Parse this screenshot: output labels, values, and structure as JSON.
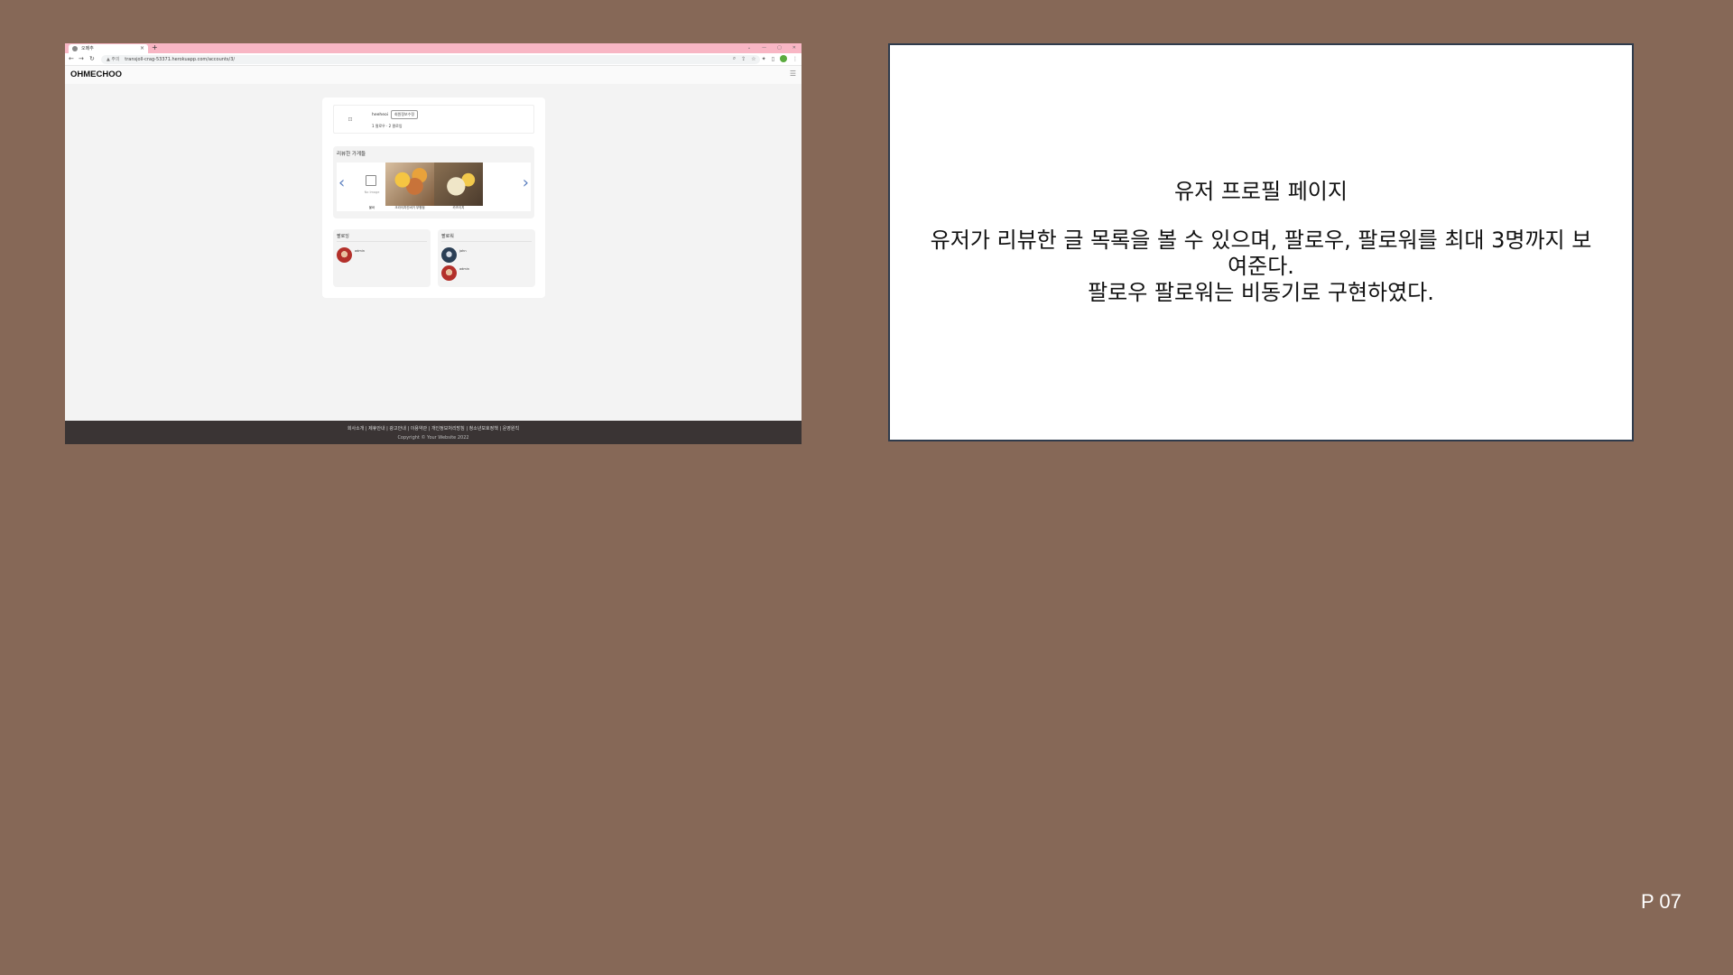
{
  "browser": {
    "tab_title": "오메추",
    "new_tab": "+",
    "window_controls": [
      "⌄",
      "—",
      "▢",
      "✕"
    ],
    "url_warning": "▲ 주의",
    "url": "transjoll-crag-53371.herokuapp.com/accounts/3/",
    "toolbar_icons": [
      "search-icon",
      "share-icon",
      "star-icon",
      "extensions-icon",
      "sidebar-icon",
      "profile-icon",
      "menu-icon"
    ]
  },
  "app": {
    "brand": "OHMECHOO",
    "menu_icon": "☰"
  },
  "profile": {
    "avatar_placeholder": "⊡",
    "username": "heeheoi",
    "follow_button": "회원정보수정",
    "counts": "1 팔로우 · 2 팔로잉"
  },
  "reviewed": {
    "title": "리뷰한 가게들",
    "stores": [
      {
        "label": "불바",
        "no_image": "No Image"
      },
      {
        "label": "크라이치킨버거 부평점"
      },
      {
        "label": "카츠이치"
      }
    ]
  },
  "following": {
    "title": "팔로잉",
    "users": [
      {
        "name": "admin"
      }
    ]
  },
  "followers": {
    "title": "팔로워",
    "users": [
      {
        "name": "john"
      },
      {
        "name": "admin"
      }
    ]
  },
  "footer": {
    "links": "회사소개 | 제휴안내 | 광고안내 | 이용약관 | 개인정보처리방침 | 청소년보호정책 | 운영원칙",
    "copyright": "Copyright © Your Website 2022"
  },
  "slide": {
    "title": "유저 프로필 페이지",
    "line1": "유저가 리뷰한 글 목록을 볼 수 있으며, 팔로우, 팔로워를 최대 3명까지 보여준다.",
    "line2": "팔로우 팔로워는 비동기로 구현하였다.",
    "page_number": "P 07"
  },
  "colors": {
    "slide_background": "#866857",
    "tab_bar": "#f8b6c4",
    "footer": "#3a3434",
    "carousel_arrow": "#5b7fbf"
  }
}
